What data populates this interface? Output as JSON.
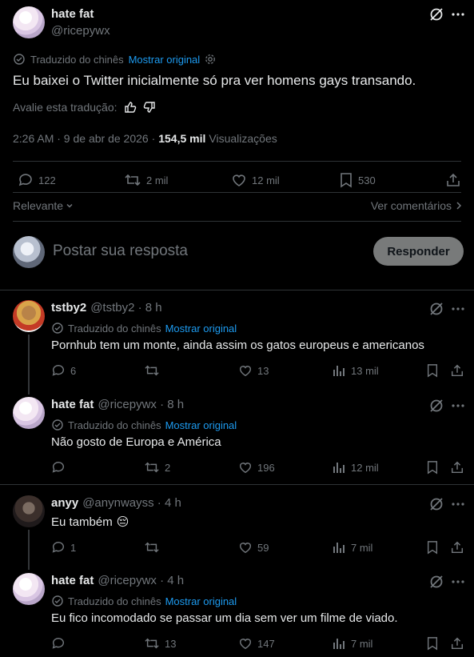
{
  "main_tweet": {
    "name": "hate fat",
    "handle": "@ricepywx",
    "translated_label": "Traduzido do chinês",
    "show_original": "Mostrar original",
    "text": "Eu baixei o Twitter inicialmente só pra ver homens gays transando.",
    "rate_label": "Avalie esta tradução:",
    "time": "2:26 AM · 9 de abr de 2026 ·",
    "views_count": "154,5 mil",
    "views_label": "Visualizações",
    "replies": "122",
    "retweets": "2 mil",
    "likes": "12 mil",
    "bookmarks": "530"
  },
  "sort": {
    "relevant": "Relevante",
    "see_comments": "Ver comentários"
  },
  "compose": {
    "placeholder": "Postar sua resposta",
    "button": "Responder"
  },
  "replies": [
    {
      "name": "tstby2",
      "handle_time": "@tstby2 · 8 h",
      "translated_label": "Traduzido do chinês",
      "show_original": "Mostrar original",
      "text": "Pornhub tem um monte, ainda assim os gatos europeus e americanos",
      "replies": "6",
      "retweets": "",
      "likes": "13",
      "views": "13 mil"
    },
    {
      "name": "hate fat",
      "handle_time": "@ricepywx · 8 h",
      "translated_label": "Traduzido do chinês",
      "show_original": "Mostrar original",
      "text": "Não gosto de Europa e América",
      "replies": "",
      "retweets": "2",
      "likes": "196",
      "views": "12 mil"
    },
    {
      "name": "anyy",
      "handle_time": "@anynwayss · 4 h",
      "text": "Eu também",
      "emoji": "😔",
      "replies": "1",
      "retweets": "",
      "likes": "59",
      "views": "7 mil"
    },
    {
      "name": "hate fat",
      "handle_time": "@ricepywx · 4 h",
      "translated_label": "Traduzido do chinês",
      "show_original": "Mostrar original",
      "text": "Eu fico incomodado se passar um dia sem ver um filme de viado.",
      "replies": "",
      "retweets": "13",
      "likes": "147",
      "views": "7 mil"
    }
  ]
}
